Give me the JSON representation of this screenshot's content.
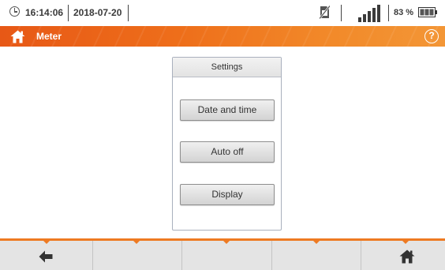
{
  "status_bar": {
    "time": "16:14:06",
    "date": "2018-07-20",
    "battery_percent": "83 %",
    "icons": [
      "clock-icon",
      "no-sim-icon",
      "signal-strength-icon",
      "battery-icon"
    ]
  },
  "title_bar": {
    "title": "Meter",
    "icons": [
      "home-icon",
      "help-icon"
    ],
    "help_glyph": "?"
  },
  "settings": {
    "header": "Settings",
    "buttons": [
      {
        "label": "Date and time"
      },
      {
        "label": "Auto off"
      },
      {
        "label": "Display"
      }
    ]
  },
  "bottom_bar": {
    "buttons": [
      "back-arrow-icon",
      "",
      "",
      "",
      "home-icon"
    ]
  },
  "colors": {
    "accent": "#ee6e1a",
    "accent_light": "#f39636",
    "panel_border": "#a9b0bd",
    "button_bg": "#d9d9d9",
    "bottom_bar_bg": "#e4e4e4"
  }
}
